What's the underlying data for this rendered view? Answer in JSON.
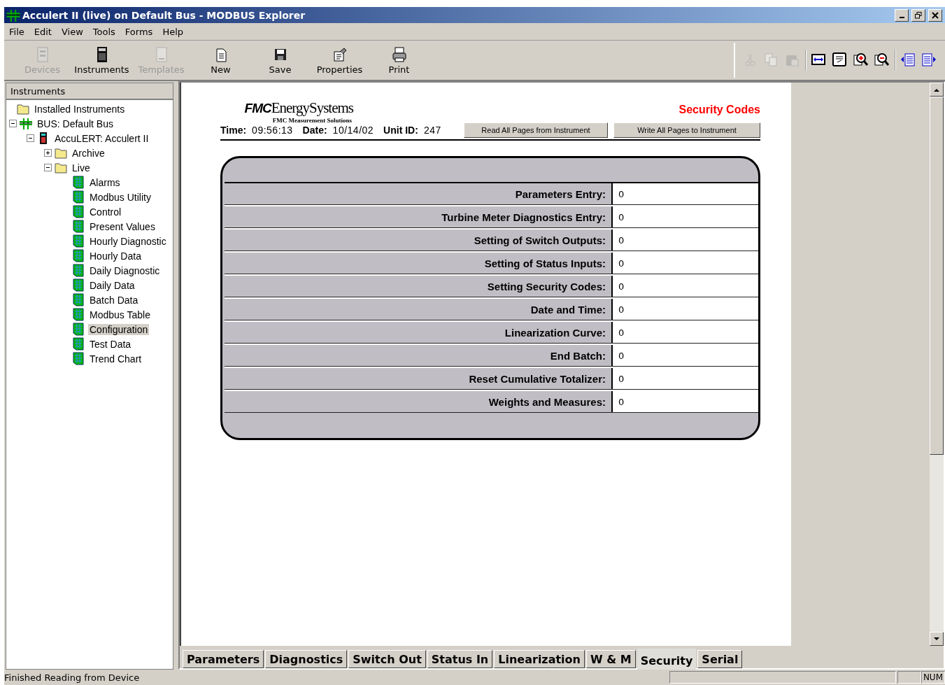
{
  "window": {
    "title": "Acculert II (live) on Default Bus - MODBUS Explorer"
  },
  "menu": [
    "File",
    "Edit",
    "View",
    "Tools",
    "Forms",
    "Help"
  ],
  "toolbar": [
    {
      "label": "Devices",
      "kind": "devices",
      "disabled": true
    },
    {
      "label": "Instruments",
      "kind": "instruments",
      "disabled": false
    },
    {
      "label": "Templates",
      "kind": "templates",
      "disabled": true
    },
    {
      "label": "New",
      "kind": "new",
      "disabled": false
    },
    {
      "label": "Save",
      "kind": "save",
      "disabled": false
    },
    {
      "label": "Properties",
      "kind": "properties",
      "disabled": false
    },
    {
      "label": "Print",
      "kind": "print",
      "disabled": false
    }
  ],
  "toolbar_right": [
    {
      "kind": "cut",
      "disabled": true
    },
    {
      "kind": "copy",
      "disabled": true
    },
    {
      "kind": "paste",
      "disabled": true
    },
    {
      "kind": "fit",
      "disabled": false
    },
    {
      "kind": "zoom100",
      "disabled": false
    },
    {
      "kind": "zoomin",
      "disabled": false
    },
    {
      "kind": "zoomout",
      "disabled": false
    },
    {
      "kind": "prev",
      "disabled": false
    },
    {
      "kind": "next",
      "disabled": false
    }
  ],
  "sidebar": {
    "title": "Instruments",
    "tree": [
      {
        "label": "Installed Instruments",
        "kind": "folder",
        "selected": false,
        "children": [
          {
            "label": "BUS: Default Bus",
            "kind": "bus",
            "expanded": true,
            "selected": false,
            "children": [
              {
                "label": "AccuLERT: Acculert II",
                "kind": "instrument",
                "expanded": true,
                "selected": false,
                "children": [
                  {
                    "label": "Archive",
                    "kind": "folder",
                    "expanded": false,
                    "selected": false
                  },
                  {
                    "label": "Live",
                    "kind": "folder",
                    "expanded": true,
                    "selected": false,
                    "children": [
                      {
                        "label": "Alarms",
                        "kind": "form",
                        "selected": false
                      },
                      {
                        "label": "Modbus Utility",
                        "kind": "form",
                        "selected": false
                      },
                      {
                        "label": "Control",
                        "kind": "form",
                        "selected": false
                      },
                      {
                        "label": "Present Values",
                        "kind": "form",
                        "selected": false
                      },
                      {
                        "label": "Hourly Diagnostic",
                        "kind": "form",
                        "selected": false
                      },
                      {
                        "label": "Hourly Data",
                        "kind": "form",
                        "selected": false
                      },
                      {
                        "label": "Daily Diagnostic",
                        "kind": "form",
                        "selected": false
                      },
                      {
                        "label": "Daily Data",
                        "kind": "form",
                        "selected": false
                      },
                      {
                        "label": "Batch Data",
                        "kind": "form",
                        "selected": false
                      },
                      {
                        "label": "Modbus Table",
                        "kind": "form",
                        "selected": false
                      },
                      {
                        "label": "Configuration",
                        "kind": "form",
                        "selected": true
                      },
                      {
                        "label": "Test Data",
                        "kind": "form",
                        "selected": false
                      },
                      {
                        "label": "Trend Chart",
                        "kind": "form",
                        "selected": false
                      }
                    ]
                  }
                ]
              }
            ]
          }
        ]
      }
    ]
  },
  "form": {
    "logo_mark": "FMC",
    "logo_name": "EnergySystems",
    "logo_sub": "FMC Measurement Solutions",
    "title": "Security Codes",
    "time_label": "Time:",
    "time": "09:56:13",
    "date_label": "Date:",
    "date": "10/14/02",
    "unit_label": "Unit ID:",
    "unit": "247",
    "buttons": [
      "Read All Pages from Instrument",
      "Write All Pages to Instrument"
    ],
    "rows": [
      {
        "label": "Parameters Entry:",
        "value": "0"
      },
      {
        "label": "Turbine Meter Diagnostics Entry:",
        "value": "0"
      },
      {
        "label": "Setting of Switch Outputs:",
        "value": "0"
      },
      {
        "label": "Setting of Status Inputs:",
        "value": "0"
      },
      {
        "label": "Setting Security Codes:",
        "value": "0"
      },
      {
        "label": "Date and Time:",
        "value": "0"
      },
      {
        "label": "Linearization Curve:",
        "value": "0"
      },
      {
        "label": "End Batch:",
        "value": "0"
      },
      {
        "label": "Reset Cumulative Totalizer:",
        "value": "0"
      },
      {
        "label": "Weights and Measures:",
        "value": "0"
      }
    ]
  },
  "tabs": [
    {
      "label": "Parameters",
      "selected": false
    },
    {
      "label": "Diagnostics",
      "selected": false
    },
    {
      "label": "Switch Out",
      "selected": false
    },
    {
      "label": "Status In",
      "selected": false
    },
    {
      "label": "Linearization",
      "selected": false
    },
    {
      "label": "W & M",
      "selected": false
    },
    {
      "label": "Security",
      "selected": true
    },
    {
      "label": "Serial",
      "selected": false
    }
  ],
  "status_bar": {
    "message": "Finished Reading from Device",
    "num": "NUM"
  }
}
